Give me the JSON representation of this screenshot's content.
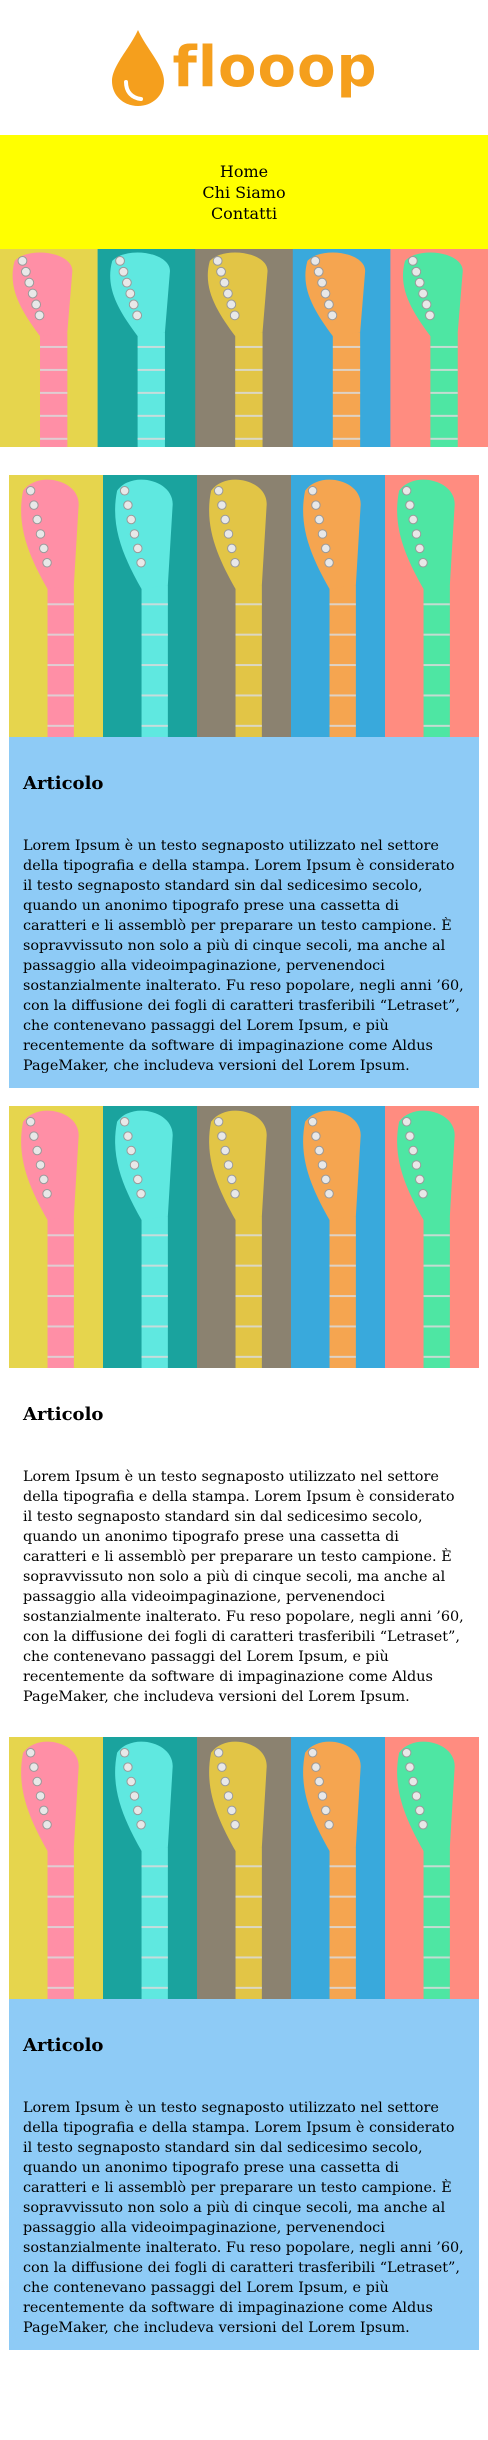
{
  "brand": {
    "name": "flooop",
    "color": "#f59f1d",
    "icon": "water-drop-icon"
  },
  "nav": {
    "background": "#ffff00",
    "items": [
      {
        "label": "Home"
      },
      {
        "label": "Chi Siamo"
      },
      {
        "label": "Contatti"
      }
    ]
  },
  "hero_image": {
    "subject": "fender-guitar-headstocks",
    "panel_colors": [
      "#e6d54d",
      "#1aa39e",
      "#8b8270",
      "#39a9dc",
      "#ff8c80"
    ],
    "headstock_colors": [
      "#ff8fa6",
      "#5fe8e0",
      "#e2c546",
      "#f5a550",
      "#4ee6a3"
    ]
  },
  "articles": [
    {
      "title": "Articolo",
      "body": "Lorem Ipsum è un testo segnaposto utilizzato nel settore della tipografia e della stampa. Lorem Ipsum è considerato il testo segnaposto standard sin dal sedicesimo secolo, quando un anonimo tipografo prese una cassetta di caratteri e li assemblò per preparare un testo campione. È sopravvissuto non solo a più di cinque secoli, ma anche al passaggio alla videoimpaginazione, pervenendoci sostanzialmente inalterato. Fu reso popolare, negli anni ’60, con la diffusione dei fogli di caratteri trasferibili “Letraset”, che contenevano passaggi del Lorem Ipsum, e più recentemente da software di impaginazione come Aldus PageMaker, che includeva versioni del Lorem Ipsum.",
      "background": "#8ecbf6"
    },
    {
      "title": "Articolo",
      "body": "Lorem Ipsum è un testo segnaposto utilizzato nel settore della tipografia e della stampa. Lorem Ipsum è considerato il testo segnaposto standard sin dal sedicesimo secolo, quando un anonimo tipografo prese una cassetta di caratteri e li assemblò per preparare un testo campione. È sopravvissuto non solo a più di cinque secoli, ma anche al passaggio alla videoimpaginazione, pervenendoci sostanzialmente inalterato. Fu reso popolare, negli anni ’60, con la diffusione dei fogli di caratteri trasferibili “Letraset”, che contenevano passaggi del Lorem Ipsum, e più recentemente da software di impaginazione come Aldus PageMaker, che includeva versioni del Lorem Ipsum.",
      "background": "#ffffff"
    },
    {
      "title": "Articolo",
      "body": "Lorem Ipsum è un testo segnaposto utilizzato nel settore della tipografia e della stampa. Lorem Ipsum è considerato il testo segnaposto standard sin dal sedicesimo secolo, quando un anonimo tipografo prese una cassetta di caratteri e li assemblò per preparare un testo campione. È sopravvissuto non solo a più di cinque secoli, ma anche al passaggio alla videoimpaginazione, pervenendoci sostanzialmente inalterato. Fu reso popolare, negli anni ’60, con la diffusione dei fogli di caratteri trasferibili “Letraset”, che contenevano passaggi del Lorem Ipsum, e più recentemente da software di impaginazione come Aldus PageMaker, che includeva versioni del Lorem Ipsum.",
      "background": "#8ecbf6"
    }
  ]
}
